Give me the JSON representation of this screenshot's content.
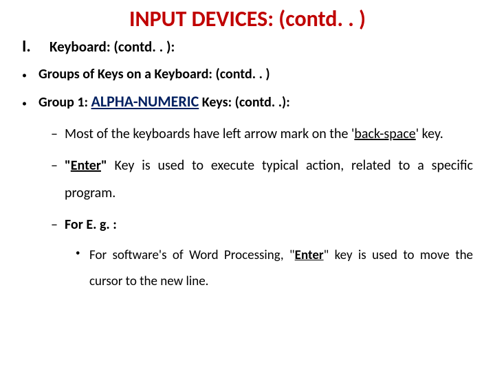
{
  "title": "INPUT DEVICES: (contd. . )",
  "roman": {
    "num": "I.",
    "text": "Keyboard: (contd. . ):"
  },
  "b1": {
    "text": "Groups of Keys on a Keyboard: (contd. . )"
  },
  "b2": {
    "pre": "Group 1: ",
    "kw": "ALPHA-NUMERIC",
    "post": " Keys: (contd. .):"
  },
  "d1": {
    "pre": "Most of the keyboards have left arrow mark on the '",
    "u1": "back-",
    "u2": "space",
    "post": "' key."
  },
  "d2": {
    "q1": "\"",
    "enter": "Enter",
    "q2": "\"",
    "rest": " Key is used to execute typical action, related to a specific program."
  },
  "d3": {
    "text": "For E. g. :"
  },
  "sub": {
    "pre": "For software's of Word Processing, \"",
    "enter": "Enter",
    "post": "\" key is used to move the cursor to the new line."
  }
}
